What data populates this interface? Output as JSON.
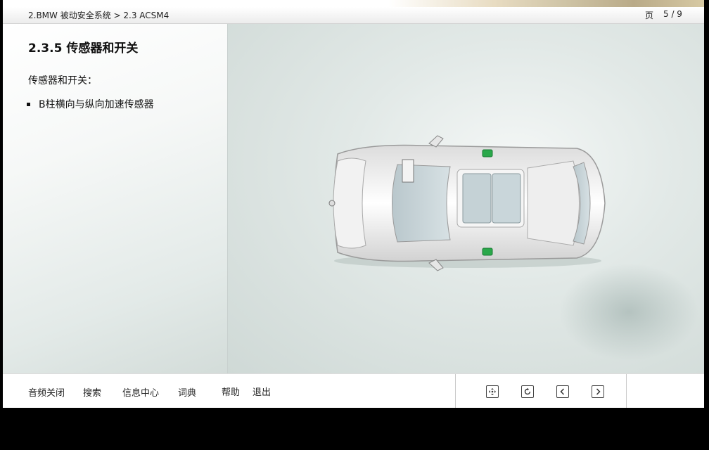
{
  "header": {
    "breadcrumb": "2.BMW 被动安全系统 > 2.3 ACSM4",
    "page_label": "页",
    "page_number": "5 / 9"
  },
  "content": {
    "title": "2.3.5 传感器和开关",
    "intro": "传感器和开关：",
    "bullets": [
      "B柱横向与纵向加速传感器"
    ]
  },
  "footer": {
    "buttons": [
      "音频关闭",
      "搜索",
      "信息中心",
      "词典",
      "帮助",
      "退出"
    ],
    "nav_icons": [
      "navigate-icon",
      "refresh-icon",
      "previous-icon",
      "next-icon"
    ]
  },
  "colors": {
    "sensor": "#2aa84a",
    "background": "#d9e2e0"
  }
}
